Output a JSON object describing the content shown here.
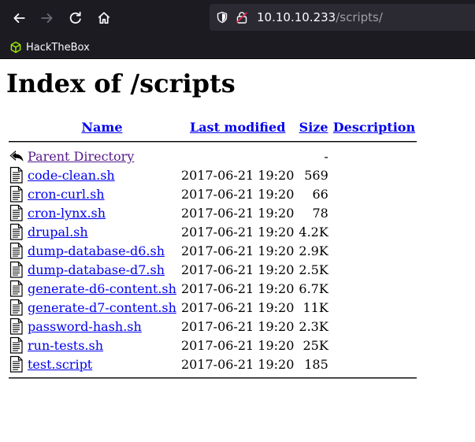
{
  "browser": {
    "url_host": "10.10.10.233",
    "url_path": "/scripts/",
    "bookmark_label": "HackTheBox"
  },
  "page": {
    "title": "Index of /scripts",
    "headers": {
      "name": "Name",
      "modified": "Last modified",
      "size": "Size",
      "description": "Description"
    },
    "parent": {
      "name": "Parent Directory",
      "size": "-"
    },
    "files": [
      {
        "name": "code-clean.sh",
        "modified": "2017-06-21 19:20",
        "size": "569"
      },
      {
        "name": "cron-curl.sh",
        "modified": "2017-06-21 19:20",
        "size": "66"
      },
      {
        "name": "cron-lynx.sh",
        "modified": "2017-06-21 19:20",
        "size": "78"
      },
      {
        "name": "drupal.sh",
        "modified": "2017-06-21 19:20",
        "size": "4.2K"
      },
      {
        "name": "dump-database-d6.sh",
        "modified": "2017-06-21 19:20",
        "size": "2.9K"
      },
      {
        "name": "dump-database-d7.sh",
        "modified": "2017-06-21 19:20",
        "size": "2.5K"
      },
      {
        "name": "generate-d6-content.sh",
        "modified": "2017-06-21 19:20",
        "size": "6.7K"
      },
      {
        "name": "generate-d7-content.sh",
        "modified": "2017-06-21 19:20",
        "size": "11K"
      },
      {
        "name": "password-hash.sh",
        "modified": "2017-06-21 19:20",
        "size": "2.3K"
      },
      {
        "name": "run-tests.sh",
        "modified": "2017-06-21 19:20",
        "size": "25K"
      },
      {
        "name": "test.script",
        "modified": "2017-06-21 19:20",
        "size": "185"
      }
    ]
  }
}
